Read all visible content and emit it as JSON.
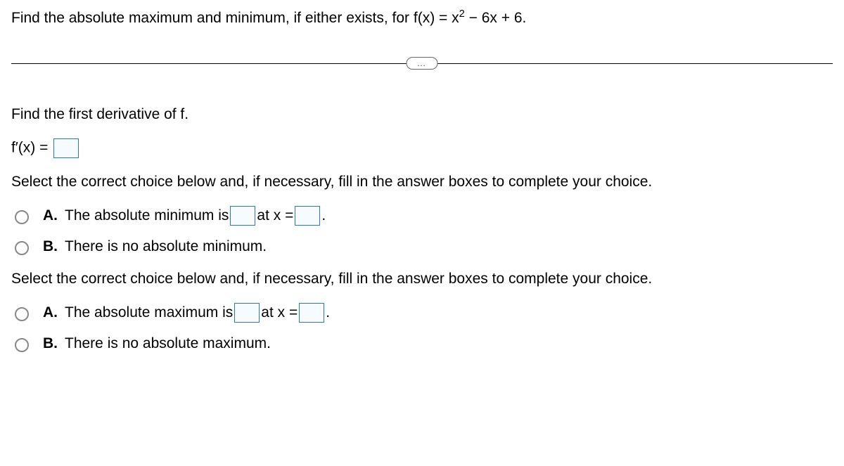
{
  "stem": {
    "prefix": "Find the absolute maximum and minimum, if either exists, for f(x) = x",
    "exponent": "2",
    "suffix": " − 6x + 6."
  },
  "divider_dots": "…",
  "part1_prompt": "Find the first derivative of f.",
  "derivative_label": "f′(x) = ",
  "select_prompt_1": "Select the correct choice below and, if necessary, fill in the answer boxes to complete your choice.",
  "min": {
    "A_label": "A.",
    "A_text_pre": "The absolute minimum is ",
    "A_text_mid": " at x = ",
    "A_text_post": ".",
    "B_label": "B.",
    "B_text": "There is no absolute minimum."
  },
  "select_prompt_2": "Select the correct choice below and, if necessary, fill in the answer boxes to complete your choice.",
  "max": {
    "A_label": "A.",
    "A_text_pre": "The absolute maximum is ",
    "A_text_mid": " at x = ",
    "A_text_post": ".",
    "B_label": "B.",
    "B_text": "There is no absolute maximum."
  }
}
